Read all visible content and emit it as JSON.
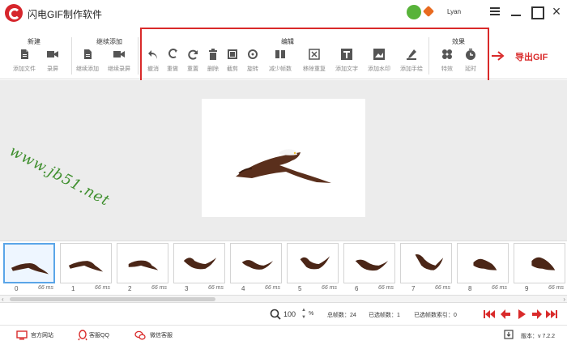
{
  "app": {
    "title": "闪电GIF制作软件",
    "username": "Lyan",
    "brand_color": "#d6262c",
    "accent_color": "#d92a2a"
  },
  "toolbar": {
    "groups": [
      {
        "title": "新建",
        "buttons": [
          {
            "label": "添加文件",
            "icon": "file-icon"
          },
          {
            "label": "录屏",
            "icon": "video-camera-icon"
          }
        ]
      },
      {
        "title": "继续添加",
        "buttons": [
          {
            "label": "继续添加",
            "icon": "file-add-icon"
          },
          {
            "label": "继续录屏",
            "icon": "video-camera-icon"
          }
        ]
      },
      {
        "title": "编辑",
        "buttons": [
          {
            "label": "撤消",
            "icon": "undo-icon"
          },
          {
            "label": "重做",
            "icon": "redo-icon"
          },
          {
            "label": "重置",
            "icon": "refresh-icon"
          },
          {
            "label": "删除",
            "icon": "trash-icon"
          },
          {
            "label": "截剪",
            "icon": "crop-icon"
          },
          {
            "label": "旋转",
            "icon": "rotate-icon"
          },
          {
            "label": "减少帧数",
            "icon": "reduce-frames-icon"
          },
          {
            "label": "移除重复",
            "icon": "remove-duplicate-icon"
          },
          {
            "label": "添加文字",
            "icon": "text-icon"
          },
          {
            "label": "添加水印",
            "icon": "watermark-icon"
          },
          {
            "label": "添加手绘",
            "icon": "brush-icon"
          }
        ]
      },
      {
        "title": "效果",
        "buttons": [
          {
            "label": "特效",
            "icon": "effects-icon"
          },
          {
            "label": "延时",
            "icon": "timer-icon"
          }
        ]
      }
    ],
    "export_label": "导出GIF"
  },
  "preview": {
    "watermark": "www.jb51.net"
  },
  "frames": [
    {
      "index": "0",
      "duration": "66 ms",
      "selected": true
    },
    {
      "index": "1",
      "duration": "66 ms"
    },
    {
      "index": "2",
      "duration": "66 ms"
    },
    {
      "index": "3",
      "duration": "66 ms"
    },
    {
      "index": "4",
      "duration": "66 ms"
    },
    {
      "index": "5",
      "duration": "66 ms"
    },
    {
      "index": "6",
      "duration": "66 ms"
    },
    {
      "index": "7",
      "duration": "66 ms"
    },
    {
      "index": "8",
      "duration": "66 ms"
    },
    {
      "index": "9",
      "duration": "66 ms"
    }
  ],
  "status": {
    "zoom": "100",
    "zoom_unit": "%",
    "total_frames": "总帧数：24",
    "selected_frames": "已选帧数：1",
    "selected_index": "已选帧数索引：0"
  },
  "footer": {
    "website": "官方网站",
    "qq": "客服QQ",
    "wechat": "微信客服",
    "version": "版本：v 7.2.2"
  }
}
